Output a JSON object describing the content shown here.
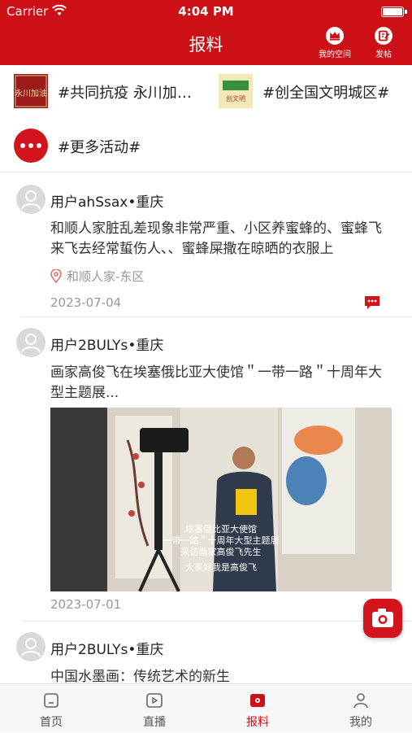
{
  "status_bar": {
    "carrier": "Carrier",
    "time": "4:04 PM"
  },
  "nav": {
    "title": "报料",
    "my_space_label": "我的空间",
    "post_label": "发帖"
  },
  "topics": [
    {
      "text": "#共同抗疫 永川加油#",
      "thumb_caption": "永川加油"
    },
    {
      "text": "#创全国文明城区#",
      "thumb_caption": "创文明"
    },
    {
      "text": "#更多活动#"
    }
  ],
  "posts": [
    {
      "user": "用户ahSsax•重庆",
      "content": "和顺人家脏乱差现象非常严重、小区养蜜蜂的、蜜蜂飞来飞去经常蜇伤人、、蜜蜂屎撒在晾晒的衣服上",
      "location": "和顺人家-东区",
      "date": "2023-07-04"
    },
    {
      "user": "用户2BULYs•重庆",
      "content": "画家高俊飞在埃塞俄比亚大使馆＂一带一路＂十周年大型主题展...",
      "video_subtitles": [
        "埃塞俄比亚大使馆",
        "一带一路＂十周年大型主题展",
        "采访画家高俊飞先生",
        "大家好我是高俊飞"
      ],
      "date": "2023-07-01"
    },
    {
      "user": "用户2BULYs•重庆",
      "content": "中国水墨画：传统艺术的新生"
    }
  ],
  "tabs": [
    {
      "label": "首页",
      "active": false
    },
    {
      "label": "直播",
      "active": false
    },
    {
      "label": "报料",
      "active": true
    },
    {
      "label": "我的",
      "active": false
    }
  ],
  "colors": {
    "brand": "#cc1016",
    "muted": "#999999",
    "tab_inactive": "#555555"
  }
}
